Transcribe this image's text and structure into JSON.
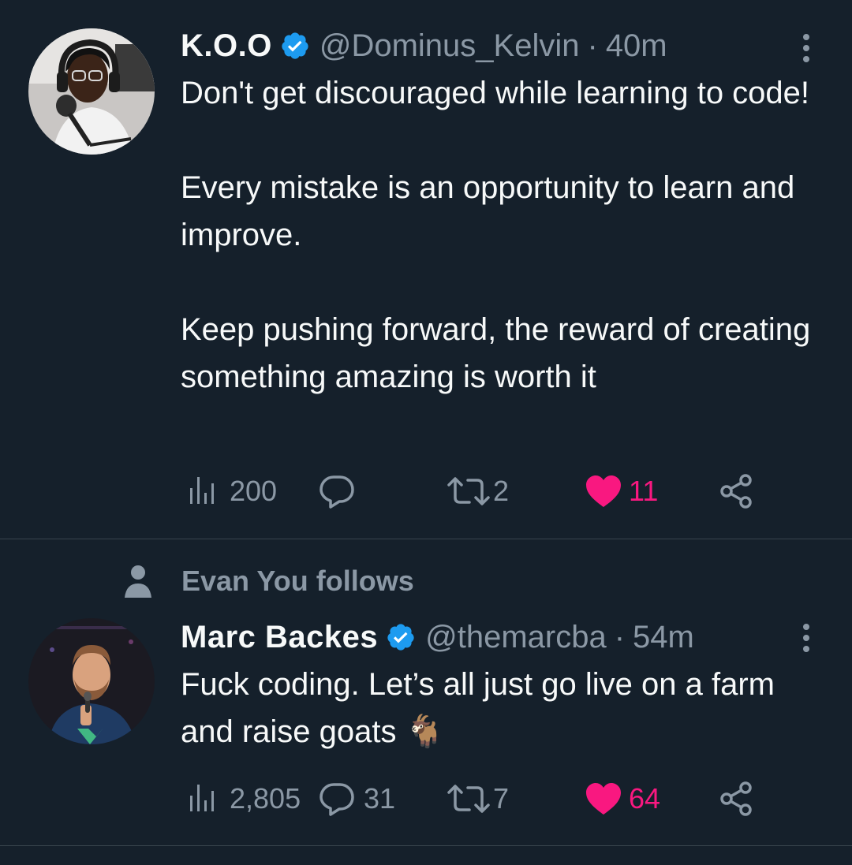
{
  "tweets": [
    {
      "name": "K.O.O",
      "handle": "@Dominus_Kelvin",
      "separator": "·",
      "time": "40m",
      "paragraphs": [
        "Don't get discouraged while learning to code!",
        "Every mistake is an opportunity to learn and improve.",
        "Keep pushing forward, the reward of creating something amazing is worth it"
      ],
      "views": "200",
      "replies": "",
      "retweets": "2",
      "likes": "11"
    },
    {
      "social_context": "Evan You follows",
      "name": "Marc Backes",
      "handle": "@themarcba",
      "separator": "·",
      "time": "54m",
      "text": "Fuck coding. Let’s all just go live on a farm and raise goats 🐐",
      "views": "2,805",
      "replies": "31",
      "retweets": "7",
      "likes": "64"
    }
  ],
  "colors": {
    "background": "#15202b",
    "text": "#f7f9f9",
    "secondary": "#8b98a5",
    "verified": "#1d9bf0",
    "like": "#f91880",
    "divider": "#38444d"
  }
}
